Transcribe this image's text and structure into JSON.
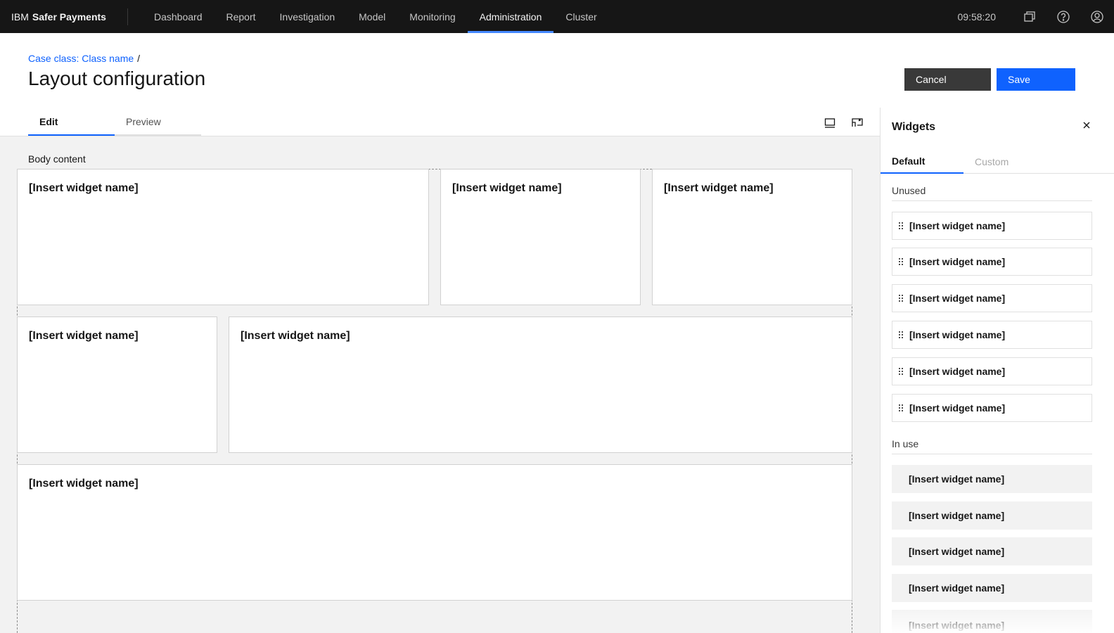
{
  "topbar": {
    "brand_prefix": "IBM",
    "brand_name": "Safer Payments",
    "nav": [
      "Dashboard",
      "Report",
      "Investigation",
      "Model",
      "Monitoring",
      "Administration",
      "Cluster"
    ],
    "active_nav": "Administration",
    "time": "09:58:20",
    "icons": [
      "switcher-icon",
      "help-icon",
      "user-avatar-icon"
    ]
  },
  "header": {
    "breadcrumb_link": "Case class: Class name",
    "breadcrumb_sep": "/",
    "title": "Layout configuration",
    "cancel_label": "Cancel",
    "save_label": "Save"
  },
  "editor": {
    "tabs": [
      "Edit",
      "Preview"
    ],
    "active_tab": "Edit",
    "body_label": "Body content",
    "widgets": [
      "[Insert widget name]",
      "[Insert widget name]",
      "[Insert widget name]",
      "[Insert widget name]",
      "[Insert widget name]",
      "[Insert widget name]"
    ]
  },
  "panel": {
    "title": "Widgets",
    "tabs": [
      "Default",
      "Custom"
    ],
    "active_tab": "Default",
    "unused_label": "Unused",
    "unused": [
      "[Insert widget name]",
      "[Insert widget name]",
      "[Insert widget name]",
      "[Insert widget name]",
      "[Insert widget name]",
      "[Insert widget name]"
    ],
    "in_use_label": "In use",
    "in_use": [
      "[Insert widget name]",
      "[Insert widget name]",
      "[Insert widget name]",
      "[Insert widget name]",
      "[Insert widget name]"
    ]
  },
  "colors": {
    "topbar_bg": "#161616",
    "accent_blue": "#0f62fe",
    "nav_underline": "#4589ff",
    "cancel_bg": "#393939",
    "canvas_bg": "#f2f2f2"
  }
}
